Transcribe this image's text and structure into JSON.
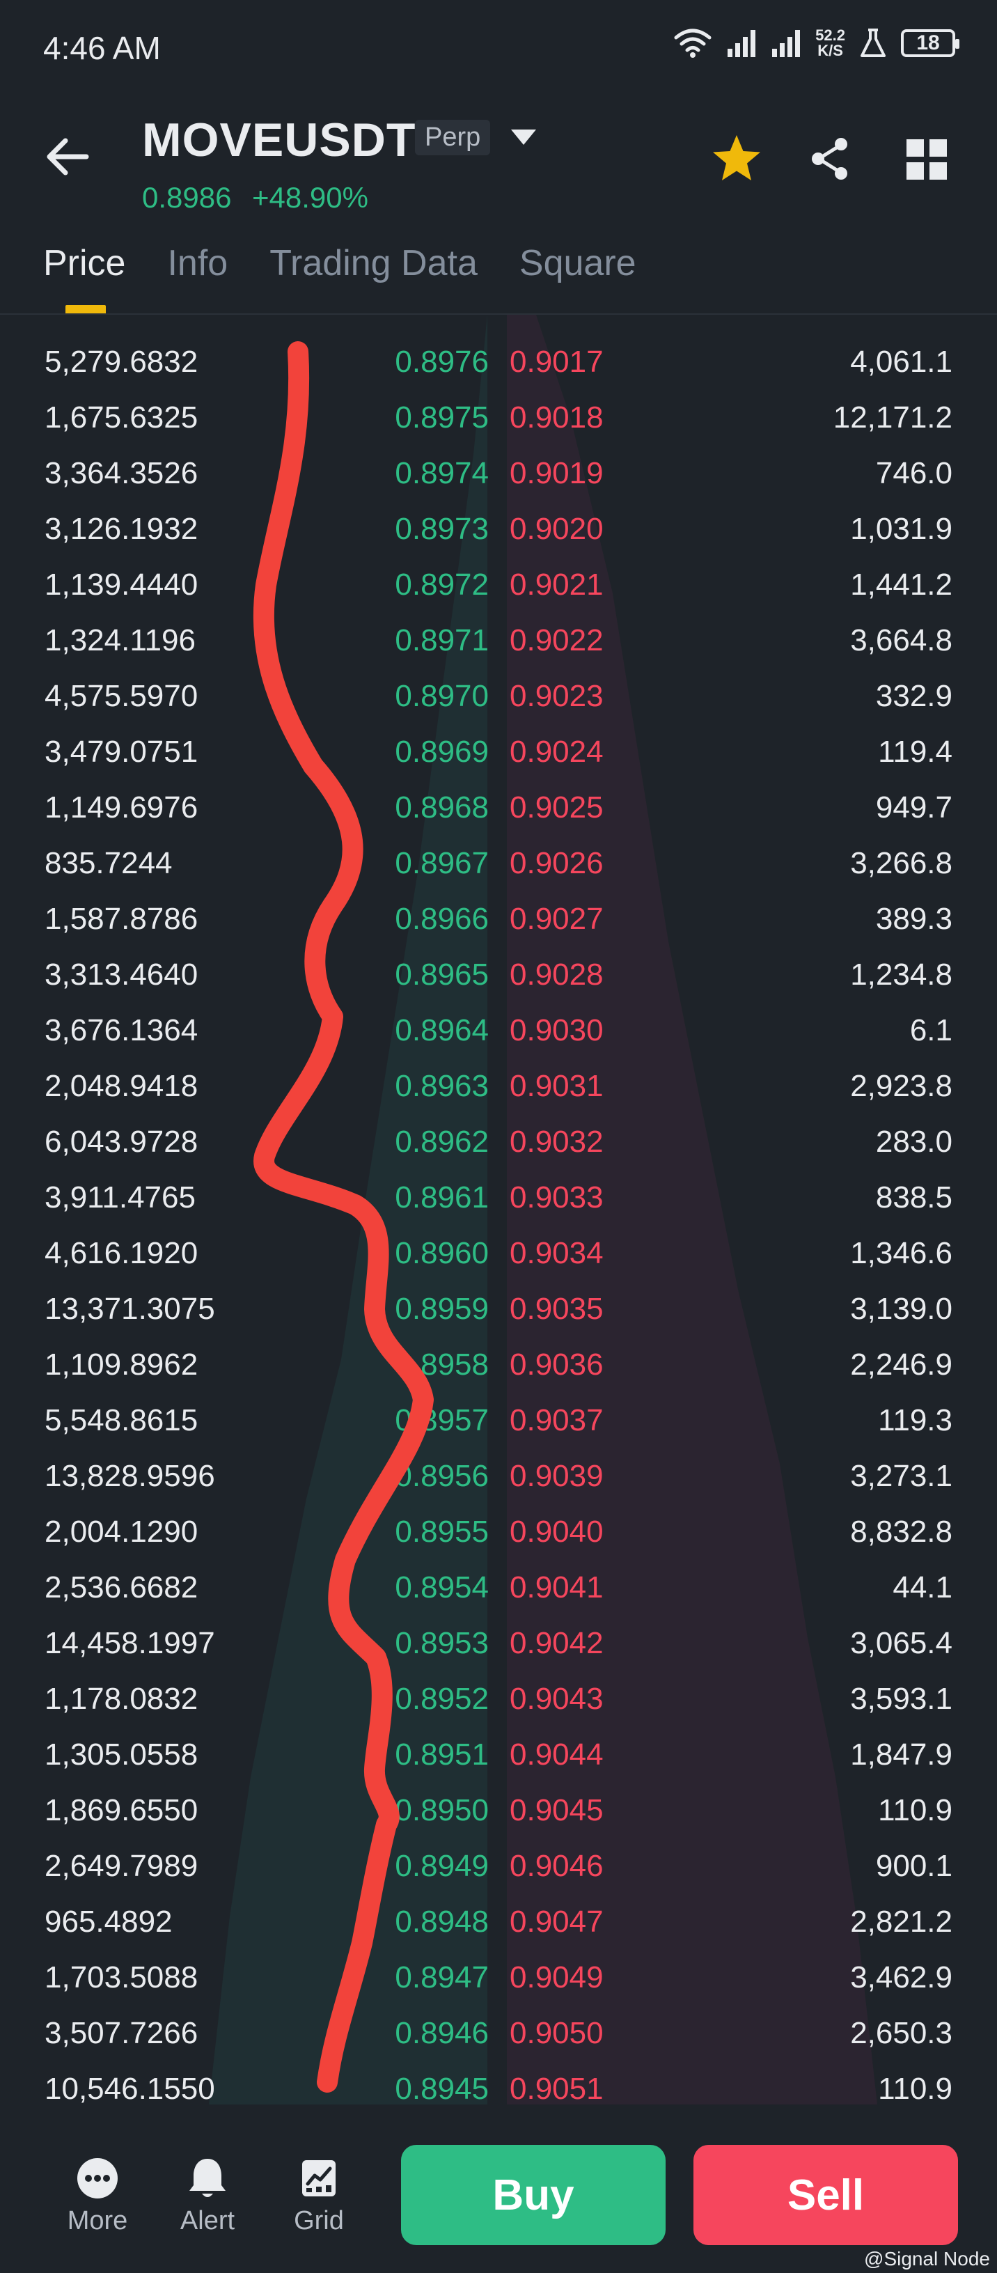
{
  "status_bar": {
    "time": "4:46 AM",
    "net_speed_value": "52.2",
    "net_speed_unit": "K/S",
    "battery": "18",
    "icons": [
      "wifi-icon",
      "signal-icon",
      "signal-icon",
      "flask-icon",
      "battery-icon"
    ]
  },
  "header": {
    "symbol": "MOVEUSDT",
    "contract_type": "Perp",
    "last_price": "0.8986",
    "change_pct": "+48.90%",
    "icons": [
      "back-arrow-icon",
      "dropdown-icon",
      "star-icon",
      "share-icon",
      "grid-icon"
    ],
    "colors": {
      "up": "#2ebd85",
      "down": "#f6465d",
      "accent": "#f0b90b",
      "background": "#1e2329"
    }
  },
  "tabs": [
    {
      "label": "Price",
      "active": true
    },
    {
      "label": "Info",
      "active": false
    },
    {
      "label": "Trading Data",
      "active": false
    },
    {
      "label": "Square",
      "active": false
    }
  ],
  "order_book": {
    "rows": [
      {
        "bid_qty": "5,279.6832",
        "bid_price": "0.8976",
        "ask_price": "0.9017",
        "ask_qty": "4,061.1"
      },
      {
        "bid_qty": "1,675.6325",
        "bid_price": "0.8975",
        "ask_price": "0.9018",
        "ask_qty": "12,171.2"
      },
      {
        "bid_qty": "3,364.3526",
        "bid_price": "0.8974",
        "ask_price": "0.9019",
        "ask_qty": "746.0"
      },
      {
        "bid_qty": "3,126.1932",
        "bid_price": "0.8973",
        "ask_price": "0.9020",
        "ask_qty": "1,031.9"
      },
      {
        "bid_qty": "1,139.4440",
        "bid_price": "0.8972",
        "ask_price": "0.9021",
        "ask_qty": "1,441.2"
      },
      {
        "bid_qty": "1,324.1196",
        "bid_price": "0.8971",
        "ask_price": "0.9022",
        "ask_qty": "3,664.8"
      },
      {
        "bid_qty": "4,575.5970",
        "bid_price": "0.8970",
        "ask_price": "0.9023",
        "ask_qty": "332.9"
      },
      {
        "bid_qty": "3,479.0751",
        "bid_price": "0.8969",
        "ask_price": "0.9024",
        "ask_qty": "119.4"
      },
      {
        "bid_qty": "1,149.6976",
        "bid_price": "0.8968",
        "ask_price": "0.9025",
        "ask_qty": "949.7"
      },
      {
        "bid_qty": "835.7244",
        "bid_price": "0.8967",
        "ask_price": "0.9026",
        "ask_qty": "3,266.8"
      },
      {
        "bid_qty": "1,587.8786",
        "bid_price": "0.8966",
        "ask_price": "0.9027",
        "ask_qty": "389.3"
      },
      {
        "bid_qty": "3,313.4640",
        "bid_price": "0.8965",
        "ask_price": "0.9028",
        "ask_qty": "1,234.8"
      },
      {
        "bid_qty": "3,676.1364",
        "bid_price": "0.8964",
        "ask_price": "0.9030",
        "ask_qty": "6.1"
      },
      {
        "bid_qty": "2,048.9418",
        "bid_price": "0.8963",
        "ask_price": "0.9031",
        "ask_qty": "2,923.8"
      },
      {
        "bid_qty": "6,043.9728",
        "bid_price": "0.8962",
        "ask_price": "0.9032",
        "ask_qty": "283.0"
      },
      {
        "bid_qty": "3,911.4765",
        "bid_price": "0.8961",
        "ask_price": "0.9033",
        "ask_qty": "838.5"
      },
      {
        "bid_qty": "4,616.1920",
        "bid_price": "0.8960",
        "ask_price": "0.9034",
        "ask_qty": "1,346.6"
      },
      {
        "bid_qty": "13,371.3075",
        "bid_price": "0.8959",
        "ask_price": "0.9035",
        "ask_qty": "3,139.0"
      },
      {
        "bid_qty": "1,109.8962",
        "bid_price": "0.8958",
        "ask_price": "0.9036",
        "ask_qty": "2,246.9"
      },
      {
        "bid_qty": "5,548.8615",
        "bid_price": "0.8957",
        "ask_price": "0.9037",
        "ask_qty": "119.3"
      },
      {
        "bid_qty": "13,828.9596",
        "bid_price": "0.8956",
        "ask_price": "0.9039",
        "ask_qty": "3,273.1"
      },
      {
        "bid_qty": "2,004.1290",
        "bid_price": "0.8955",
        "ask_price": "0.9040",
        "ask_qty": "8,832.8"
      },
      {
        "bid_qty": "2,536.6682",
        "bid_price": "0.8954",
        "ask_price": "0.9041",
        "ask_qty": "44.1"
      },
      {
        "bid_qty": "14,458.1997",
        "bid_price": "0.8953",
        "ask_price": "0.9042",
        "ask_qty": "3,065.4"
      },
      {
        "bid_qty": "1,178.0832",
        "bid_price": "0.8952",
        "ask_price": "0.9043",
        "ask_qty": "3,593.1"
      },
      {
        "bid_qty": "1,305.0558",
        "bid_price": "0.8951",
        "ask_price": "0.9044",
        "ask_qty": "1,847.9"
      },
      {
        "bid_qty": "1,869.6550",
        "bid_price": "0.8950",
        "ask_price": "0.9045",
        "ask_qty": "110.9"
      },
      {
        "bid_qty": "2,649.7989",
        "bid_price": "0.8949",
        "ask_price": "0.9046",
        "ask_qty": "900.1"
      },
      {
        "bid_qty": "965.4892",
        "bid_price": "0.8948",
        "ask_price": "0.9047",
        "ask_qty": "2,821.2"
      },
      {
        "bid_qty": "1,703.5088",
        "bid_price": "0.8947",
        "ask_price": "0.9049",
        "ask_qty": "3,462.9"
      },
      {
        "bid_qty": "3,507.7266",
        "bid_price": "0.8946",
        "ask_price": "0.9050",
        "ask_qty": "2,650.3"
      },
      {
        "bid_qty": "10,546.1550",
        "bid_price": "0.8945",
        "ask_price": "0.9051",
        "ask_qty": "110.9"
      }
    ]
  },
  "bottom_bar": {
    "more_label": "More",
    "alert_label": "Alert",
    "grid_label": "Grid",
    "buy_label": "Buy",
    "sell_label": "Sell",
    "icons": [
      "more-icon",
      "bell-icon",
      "grid-bot-icon"
    ]
  },
  "watermark": "@Signal Node"
}
